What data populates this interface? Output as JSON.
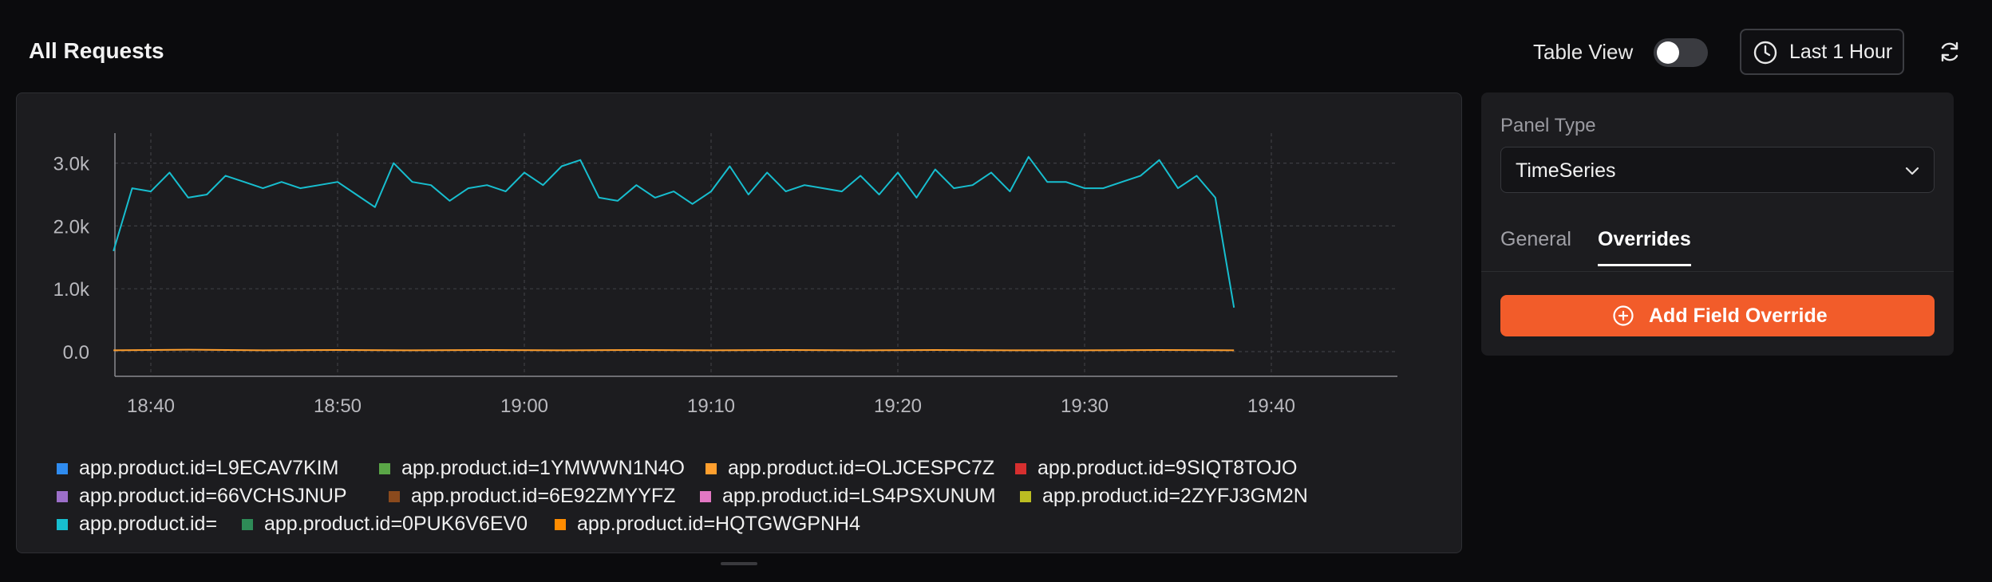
{
  "header": {
    "title": "All Requests",
    "table_view_label": "Table View",
    "table_view_enabled": false,
    "time_range_label": "Last 1 Hour",
    "clock_icon": "clock-icon",
    "refresh_icon": "refresh-icon"
  },
  "settings": {
    "panel_type_label": "Panel Type",
    "panel_type_value": "TimeSeries",
    "tabs": [
      {
        "label": "General",
        "active": false
      },
      {
        "label": "Overrides",
        "active": true
      }
    ],
    "add_override_label": "Add Field Override",
    "accent_color": "#f25c2a"
  },
  "chart_data": {
    "type": "line",
    "ylim": [
      0,
      3500
    ],
    "y_ticks": [
      {
        "value": 0,
        "label": "0.0"
      },
      {
        "value": 1000,
        "label": "1.0k"
      },
      {
        "value": 2000,
        "label": "2.0k"
      },
      {
        "value": 3000,
        "label": "3.0k"
      }
    ],
    "xlim": [
      "18:38",
      "18:48"
    ],
    "x_ticks": [
      "18:40",
      "18:50",
      "19:00",
      "19:10",
      "19:20",
      "19:30",
      "19:40"
    ],
    "grid": true,
    "legend_position": "bottom",
    "series": [
      {
        "name": "app.product.id=",
        "color": "#17becf",
        "x": [
          "18:38",
          "18:39",
          "18:40",
          "18:41",
          "18:42",
          "18:43",
          "18:44",
          "18:45",
          "18:46",
          "18:47",
          "18:48",
          "18:49",
          "18:50",
          "18:51",
          "18:52",
          "18:53",
          "18:54",
          "18:55",
          "18:56",
          "18:57",
          "18:58",
          "18:59",
          "19:00",
          "19:01",
          "19:02",
          "19:03",
          "19:04",
          "19:05",
          "19:06",
          "19:07",
          "19:08",
          "19:09",
          "19:10",
          "19:11",
          "19:12",
          "19:13",
          "19:14",
          "19:15",
          "19:16",
          "19:17",
          "19:18",
          "19:19",
          "19:20",
          "19:21",
          "19:22",
          "19:23",
          "19:24",
          "19:25",
          "19:26",
          "19:27",
          "19:28",
          "19:29",
          "19:30",
          "19:31",
          "19:32",
          "19:33",
          "19:34",
          "19:35",
          "19:36",
          "19:37",
          "19:38"
        ],
        "values": [
          1600,
          2600,
          2550,
          2850,
          2450,
          2500,
          2800,
          2700,
          2600,
          2700,
          2600,
          2650,
          2700,
          2500,
          2300,
          3000,
          2700,
          2650,
          2400,
          2600,
          2650,
          2550,
          2850,
          2650,
          2950,
          3050,
          2450,
          2400,
          2650,
          2450,
          2550,
          2350,
          2550,
          2950,
          2500,
          2850,
          2550,
          2650,
          2600,
          2550,
          2800,
          2500,
          2850,
          2450,
          2900,
          2600,
          2650,
          2850,
          2550,
          3100,
          2700,
          2700,
          2600,
          2600,
          2700,
          2800,
          3050,
          2600,
          2800,
          2450,
          700
        ]
      },
      {
        "name": "app.product.id=OLJCESPC7Z",
        "color": "#ff9f2e",
        "x": [
          "18:38",
          "18:42",
          "18:46",
          "18:50",
          "18:54",
          "18:58",
          "19:02",
          "19:06",
          "19:10",
          "19:14",
          "19:18",
          "19:22",
          "19:26",
          "19:30",
          "19:34",
          "19:38"
        ],
        "values": [
          20,
          30,
          20,
          25,
          20,
          25,
          20,
          25,
          20,
          25,
          20,
          25,
          20,
          20,
          25,
          20
        ]
      }
    ],
    "legend": [
      {
        "label": "app.product.id=L9ECAV7KIM",
        "color": "#2f8cf0"
      },
      {
        "label": "app.product.id=1YMWWN1N4O",
        "color": "#5aa647"
      },
      {
        "label": "app.product.id=OLJCESPC7Z",
        "color": "#ff9f2e"
      },
      {
        "label": "app.product.id=9SIQT8TOJO",
        "color": "#d62f2f"
      },
      {
        "label": "app.product.id=66VCHSJNUP",
        "color": "#9c6fc9"
      },
      {
        "label": "app.product.id=6E92ZMYYFZ",
        "color": "#8b4a1d"
      },
      {
        "label": "app.product.id=LS4PSXUNUM",
        "color": "#e277c3"
      },
      {
        "label": "app.product.id=2ZYFJ3GM2N",
        "color": "#bcbd22"
      },
      {
        "label": "app.product.id=",
        "color": "#17becf"
      },
      {
        "label": "app.product.id=0PUK6V6EV0",
        "color": "#2e8b57"
      },
      {
        "label": "app.product.id=HQTGWGPNH4",
        "color": "#ff8c00"
      }
    ]
  }
}
